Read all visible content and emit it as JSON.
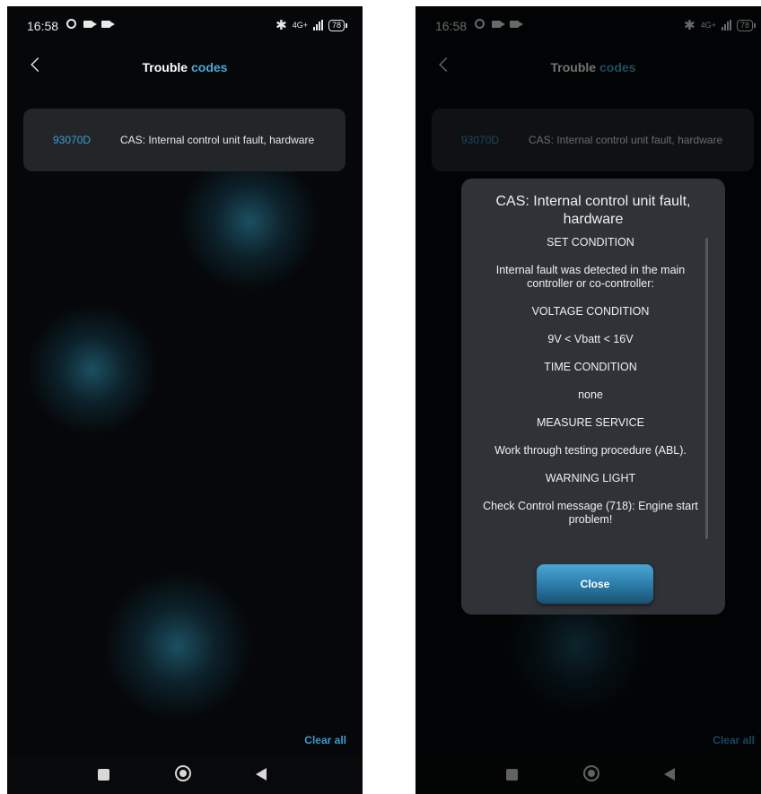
{
  "status_bar": {
    "time": "16:58",
    "network": "4G+",
    "battery": "78"
  },
  "header": {
    "title_part1": "Trouble",
    "title_part2": "codes"
  },
  "trouble_code": {
    "id": "93070D",
    "description": "CAS: Internal control unit fault, hardware"
  },
  "clear_all_label": "Clear all",
  "dialog": {
    "title": "CAS: Internal control unit fault, hardware",
    "lines": [
      "SET CONDITION",
      "Internal fault was detected in the main controller or co-controller:",
      "VOLTAGE CONDITION",
      "9V < Vbatt < 16V",
      "TIME CONDITION",
      "none",
      "MEASURE SERVICE",
      "Work through testing procedure (ABL).",
      "WARNING LIGHT",
      "Check Control message (718): Engine start problem!"
    ],
    "close_label": "Close"
  },
  "colors": {
    "accent": "#3a9bd2",
    "background": "#050709",
    "card": "#232629",
    "dialog": "#2f3236"
  }
}
